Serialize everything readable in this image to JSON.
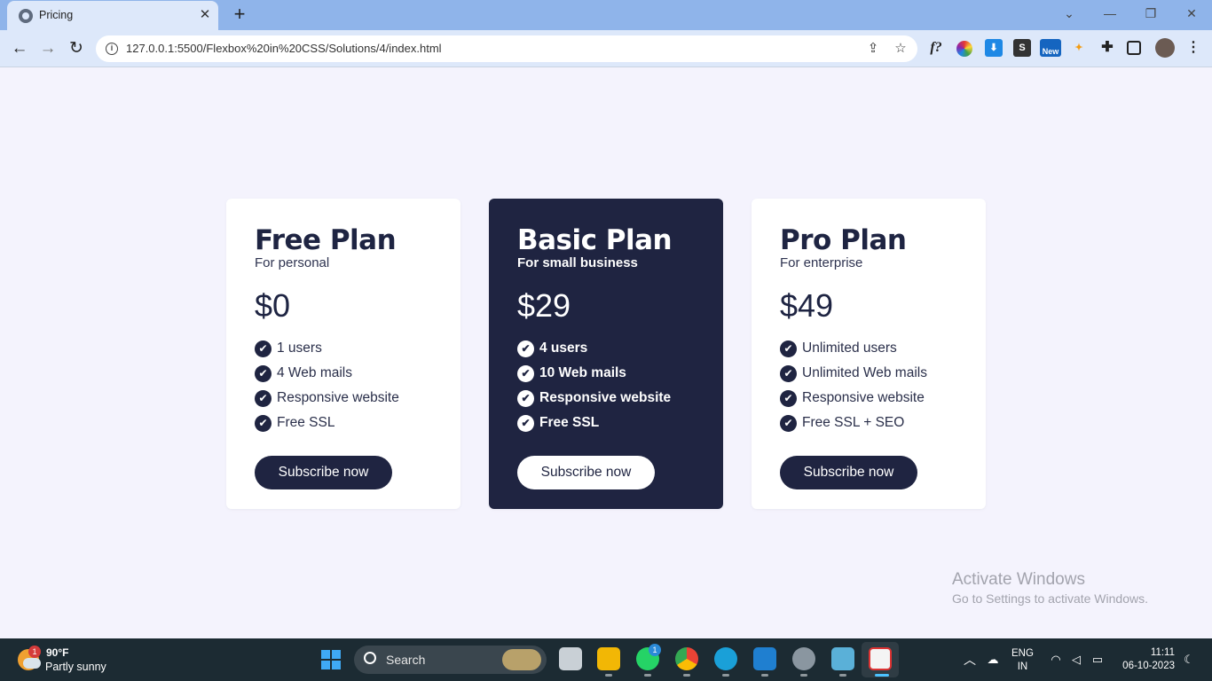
{
  "browser": {
    "tab_title": "Pricing",
    "url": "127.0.0.1:5500/Flexbox%20in%20CSS/Solutions/4/index.html",
    "extension_new_badge": "New",
    "extension_s_label": "S",
    "extension_f_label": "f?"
  },
  "plans": [
    {
      "name": "Free Plan",
      "subtitle": "For personal",
      "price": "$0",
      "features": [
        "1 users",
        "4 Web mails",
        "Responsive website",
        "Free SSL"
      ],
      "button": "Subscribe now"
    },
    {
      "name": "Basic Plan",
      "subtitle": "For small business",
      "price": "$29",
      "features": [
        "4 users",
        "10 Web mails",
        "Responsive website",
        "Free SSL"
      ],
      "button": "Subscribe now"
    },
    {
      "name": "Pro Plan",
      "subtitle": "For enterprise",
      "price": "$49",
      "features": [
        "Unlimited users",
        "Unlimited Web mails",
        "Responsive website",
        "Free SSL + SEO"
      ],
      "button": "Subscribe now"
    }
  ],
  "watermark": {
    "title": "Activate Windows",
    "subtitle": "Go to Settings to activate Windows."
  },
  "taskbar": {
    "weather_badge": "1",
    "temperature": "90°F",
    "condition": "Partly sunny",
    "search_label": "Search",
    "whatsapp_badge": "1",
    "language": "ENG",
    "region": "IN",
    "time": "11:11",
    "date": "06-10-2023"
  },
  "colors": {
    "accent_navy": "#1f2441",
    "page_background": "#f4f3fd",
    "tabstrip": "#8fb4ea"
  }
}
